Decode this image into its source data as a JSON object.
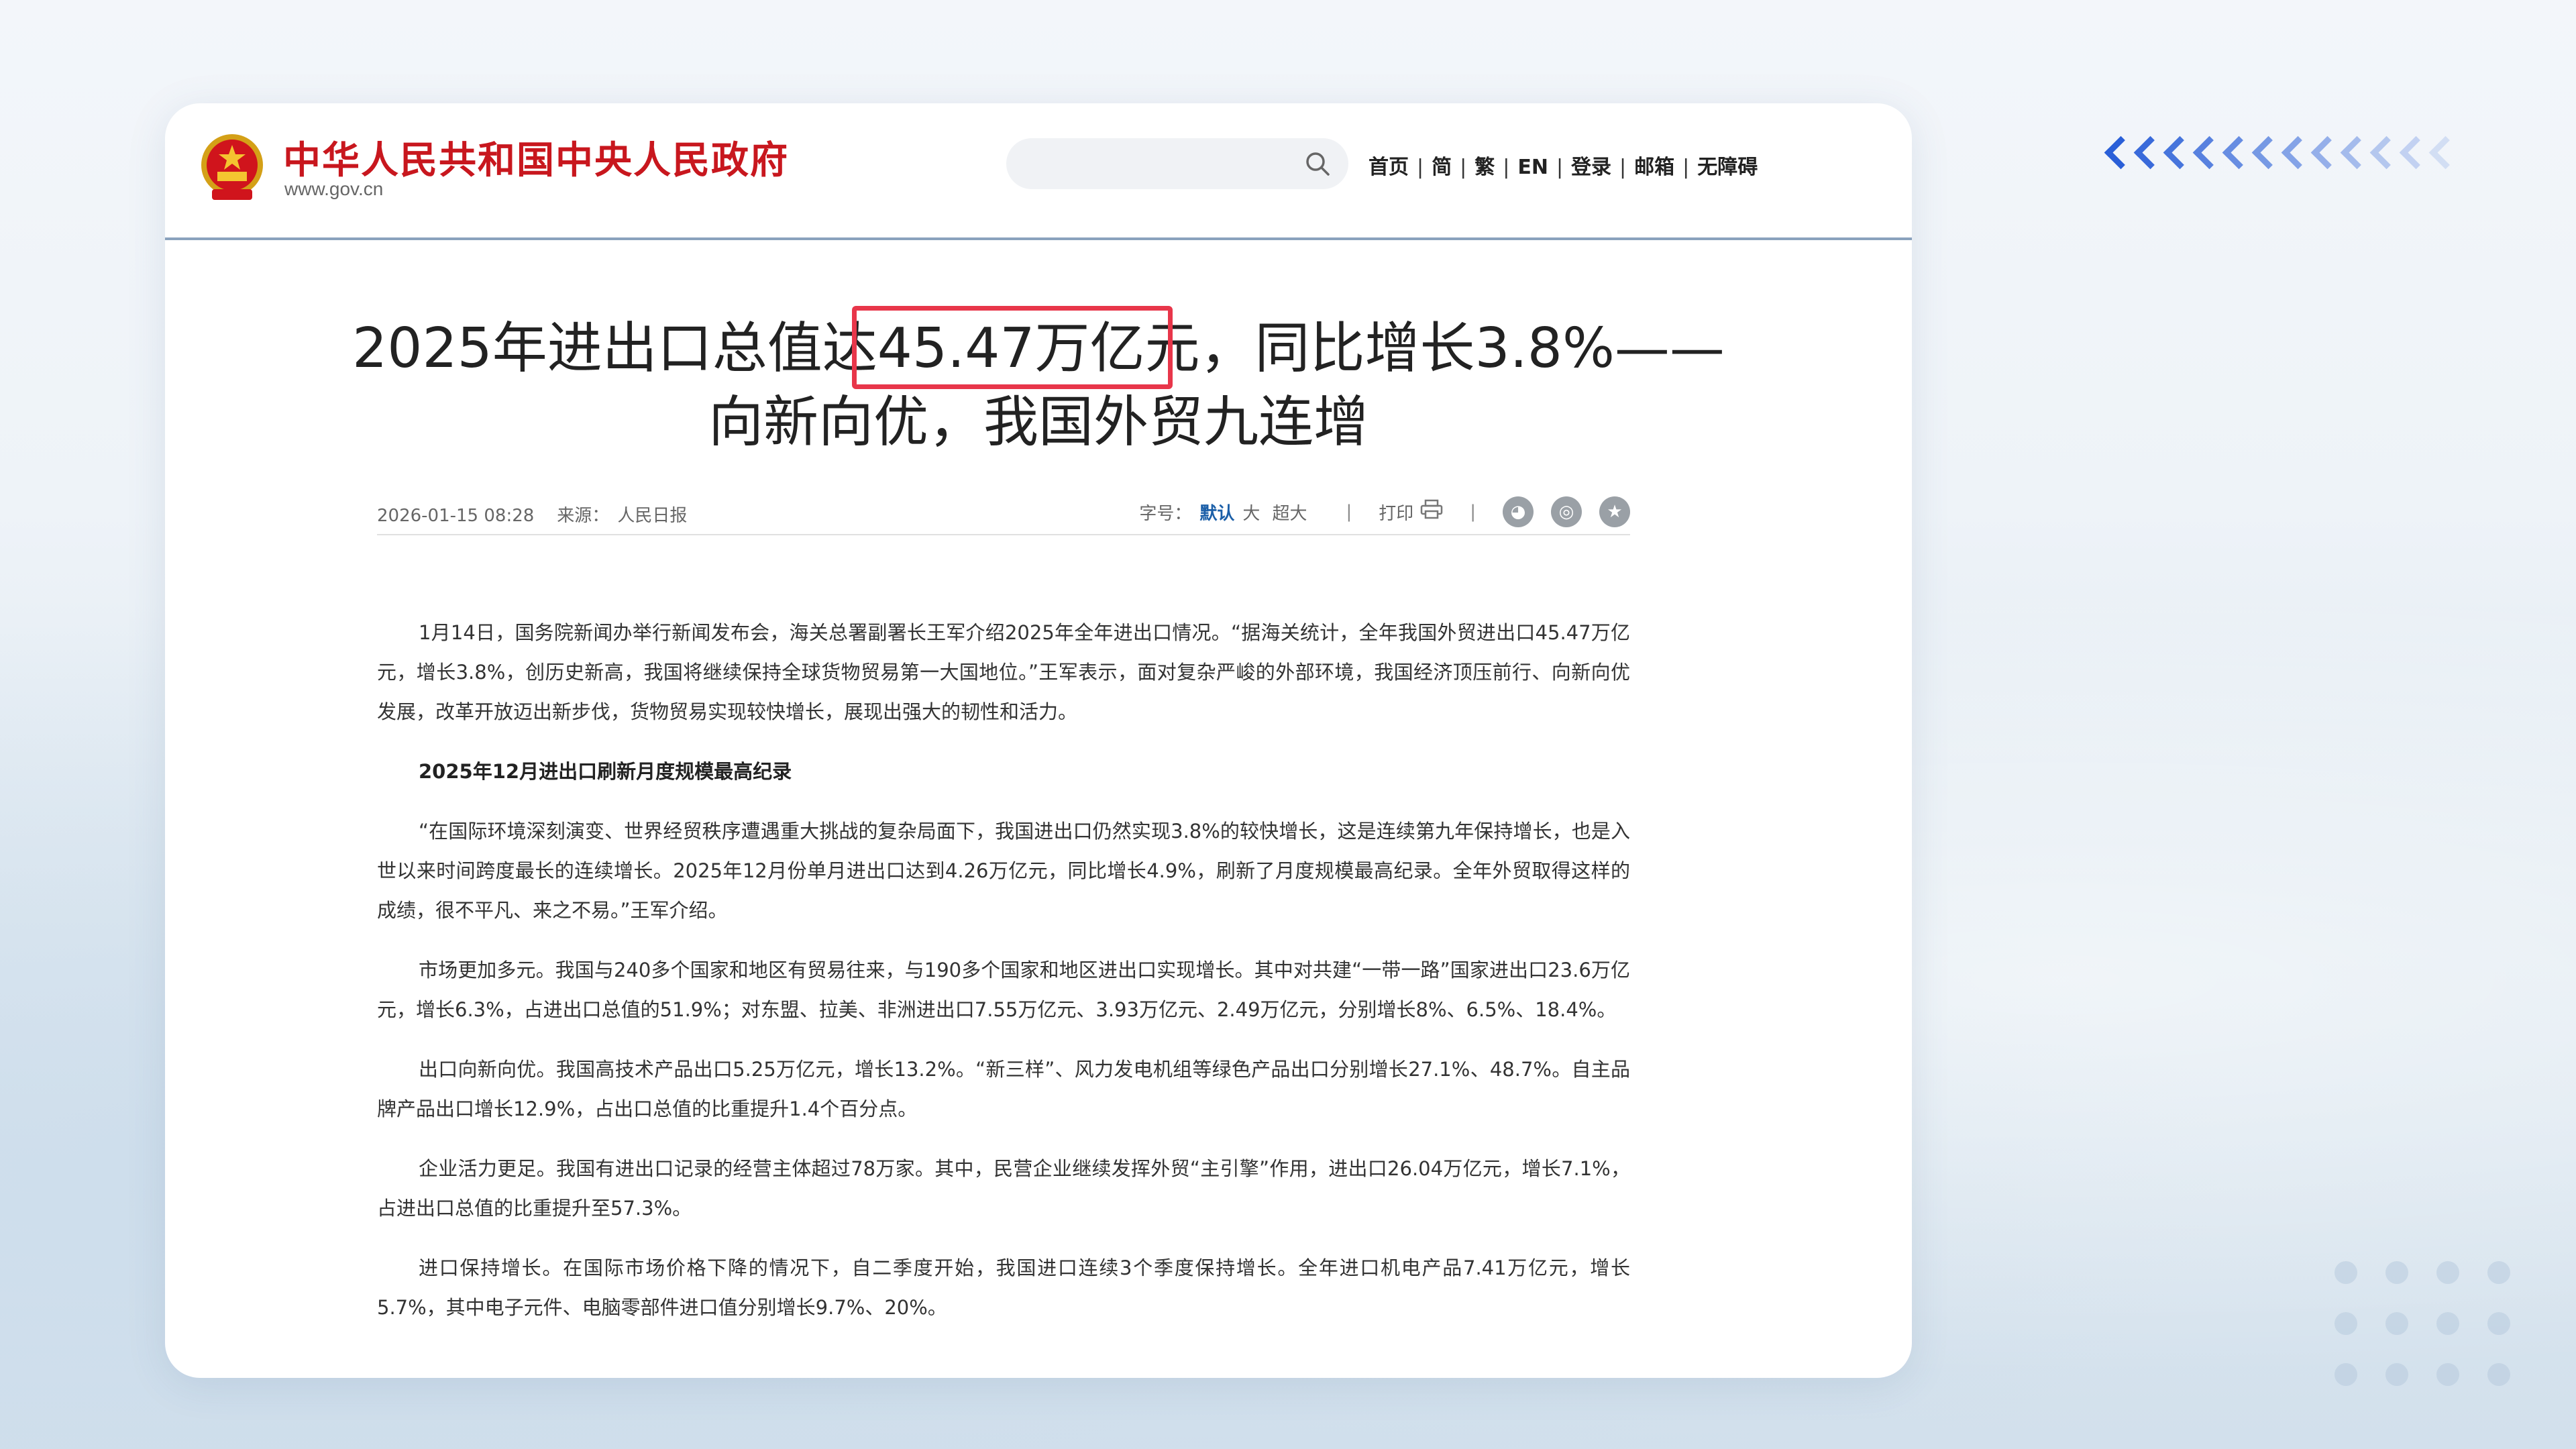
{
  "site": {
    "name": "中华人民共和国中央人民政府",
    "url": "www.gov.cn"
  },
  "nav": {
    "items": [
      "首页",
      "简",
      "繁",
      "EN",
      "登录",
      "邮箱",
      "无障碍"
    ]
  },
  "article": {
    "title_line1_pre": "2025年进出口总值达",
    "title_line1_highlight": "45.47万亿元，",
    "title_line1_post": "同比增长3.8%——",
    "title_line2": "向新向优，我国外贸九连增",
    "date": "2026-01-15 08:28",
    "source_label": "来源：",
    "source": "人民日报",
    "font_size_label": "字号：",
    "font_size_options": [
      "默认",
      "大",
      "超大"
    ],
    "print_label": "打印",
    "share_icons": [
      "weibo-icon",
      "wechat-icon",
      "favorite-icon"
    ],
    "paragraphs": [
      {
        "type": "para",
        "text": "1月14日，国务院新闻办举行新闻发布会，海关总署副署长王军介绍2025年全年进出口情况。“据海关统计，全年我国外贸进出口45.47万亿元，增长3.8%，创历史新高，我国将继续保持全球货物贸易第一大国地位。”王军表示，面对复杂严峻的外部环境，我国经济顶压前行、向新向优发展，改革开放迈出新步伐，货物贸易实现较快增长，展现出强大的韧性和活力。"
      },
      {
        "type": "subhead",
        "text": "2025年12月进出口刷新月度规模最高纪录"
      },
      {
        "type": "para",
        "text": "“在国际环境深刻演变、世界经贸秩序遭遇重大挑战的复杂局面下，我国进出口仍然实现3.8%的较快增长，这是连续第九年保持增长，也是入世以来时间跨度最长的连续增长。2025年12月份单月进出口达到4.26万亿元，同比增长4.9%，刷新了月度规模最高纪录。全年外贸取得这样的成绩，很不平凡、来之不易。”王军介绍。"
      },
      {
        "type": "para",
        "text": "市场更加多元。我国与240多个国家和地区有贸易往来，与190多个国家和地区进出口实现增长。其中对共建“一带一路”国家进出口23.6万亿元，增长6.3%，占进出口总值的51.9%；对东盟、拉美、非洲进出口7.55万亿元、3.93万亿元、2.49万亿元，分别增长8%、6.5%、18.4%。"
      },
      {
        "type": "para",
        "text": "出口向新向优。我国高技术产品出口5.25万亿元，增长13.2%。“新三样”、风力发电机组等绿色产品出口分别增长27.1%、48.7%。自主品牌产品出口增长12.9%，占出口总值的比重提升1.4个百分点。"
      },
      {
        "type": "para",
        "text": "企业活力更足。我国有进出口记录的经营主体超过78万家。其中，民营企业继续发挥外贸“主引擎”作用，进出口26.04万亿元，增长7.1%，占进出口总值的比重提升至57.3%。"
      },
      {
        "type": "para",
        "text": "进口保持增长。在国际市场价格下降的情况下，自二季度开始，我国进口连续3个季度保持增长。全年进口机电产品7.41万亿元，增长5.7%，其中电子元件、电脑零部件进口值分别增长9.7%、20%。"
      }
    ]
  },
  "colors": {
    "brand_red": "#c8171e",
    "highlight_border": "#e8364a",
    "accent_blue": "#1b5fa8",
    "chevron_blue": "#2a5fd8"
  }
}
